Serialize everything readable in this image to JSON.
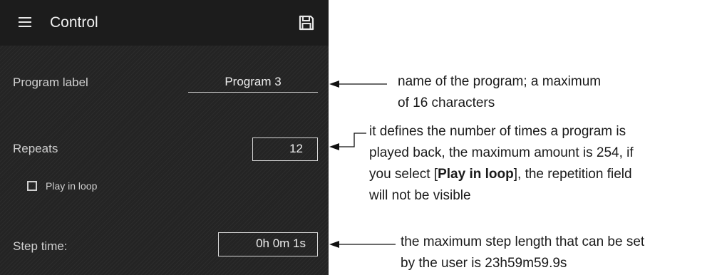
{
  "appbar": {
    "title": "Control",
    "menu_icon": "hamburger-menu-icon",
    "save_icon": "floppy-save-icon"
  },
  "form": {
    "program_label": {
      "label": "Program label",
      "value": "Program 3"
    },
    "repeats": {
      "label": "Repeats",
      "value": "12"
    },
    "play_in_loop": {
      "label": "Play in loop",
      "checked": false
    },
    "step_time": {
      "label": "Step time:",
      "value": "0h 0m 1s"
    }
  },
  "annotations": {
    "program_label": {
      "line1": "name of the program; a maximum",
      "line2": "of 16 characters"
    },
    "repeats": {
      "line1": "it defines the number of times a program is",
      "line2": "played back, the maximum amount is 254, if",
      "line3_prefix": "you select [",
      "line3_bold": "Play in loop",
      "line3_suffix": "], the repetition field",
      "line4": "will not be visible"
    },
    "step_time": {
      "line1": "the maximum step length that can be set",
      "line2": "by the user is 23h59m59.9s"
    }
  },
  "colors": {
    "panel": "#242424",
    "appbar": "#1c1c1c",
    "text": "#cfcfcf",
    "annotation": "#1a1a1a"
  }
}
